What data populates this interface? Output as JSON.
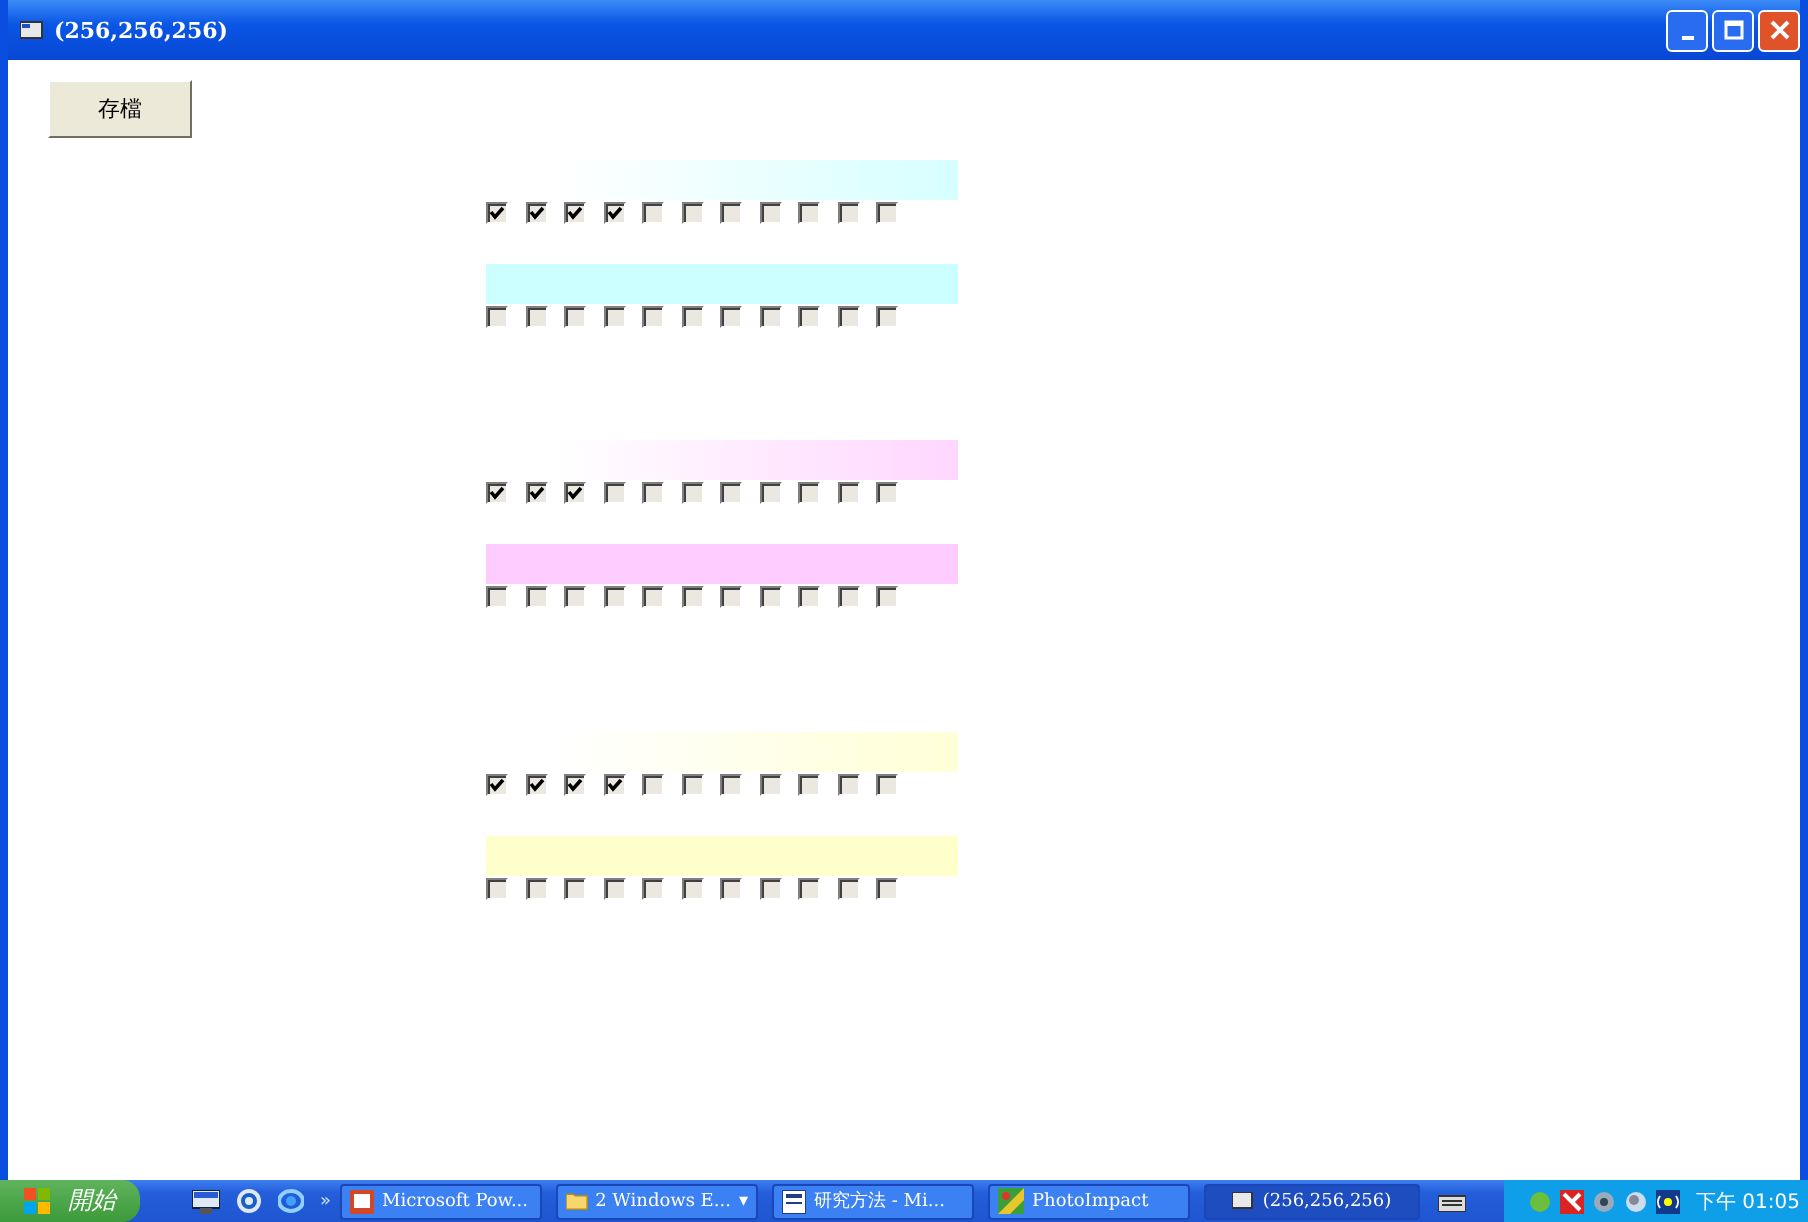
{
  "window": {
    "title": "(256,256,256)"
  },
  "save_button": {
    "label": "存檔"
  },
  "groups": [
    {
      "color": "#ccffff",
      "rows": [
        {
          "checked": [
            true,
            true,
            true,
            true,
            false,
            false,
            false,
            false,
            false,
            false,
            false
          ]
        },
        {
          "checked": [
            false,
            false,
            false,
            false,
            false,
            false,
            false,
            false,
            false,
            false,
            false
          ]
        }
      ]
    },
    {
      "color": "#ffccff",
      "rows": [
        {
          "checked": [
            true,
            true,
            true,
            false,
            false,
            false,
            false,
            false,
            false,
            false,
            false
          ]
        },
        {
          "checked": [
            false,
            false,
            false,
            false,
            false,
            false,
            false,
            false,
            false,
            false,
            false
          ]
        }
      ]
    },
    {
      "color": "#ffffcc",
      "rows": [
        {
          "checked": [
            true,
            true,
            true,
            true,
            false,
            false,
            false,
            false,
            false,
            false,
            false
          ]
        },
        {
          "checked": [
            false,
            false,
            false,
            false,
            false,
            false,
            false,
            false,
            false,
            false,
            false
          ]
        }
      ]
    }
  ],
  "taskbar": {
    "start": "開始",
    "more": "»",
    "tasks": [
      {
        "label": "Microsoft Pow...",
        "kind": "slide",
        "selected": false
      },
      {
        "label": "2 Windows E...",
        "kind": "folder",
        "selected": false,
        "caret": "▾"
      },
      {
        "label": "研究方法 - Mi...",
        "kind": "doc",
        "selected": false
      },
      {
        "label": "PhotoImpact",
        "kind": "photo",
        "selected": false
      },
      {
        "label": "(256,256,256)",
        "kind": "app",
        "selected": true
      }
    ],
    "clock": "下午 01:05"
  }
}
